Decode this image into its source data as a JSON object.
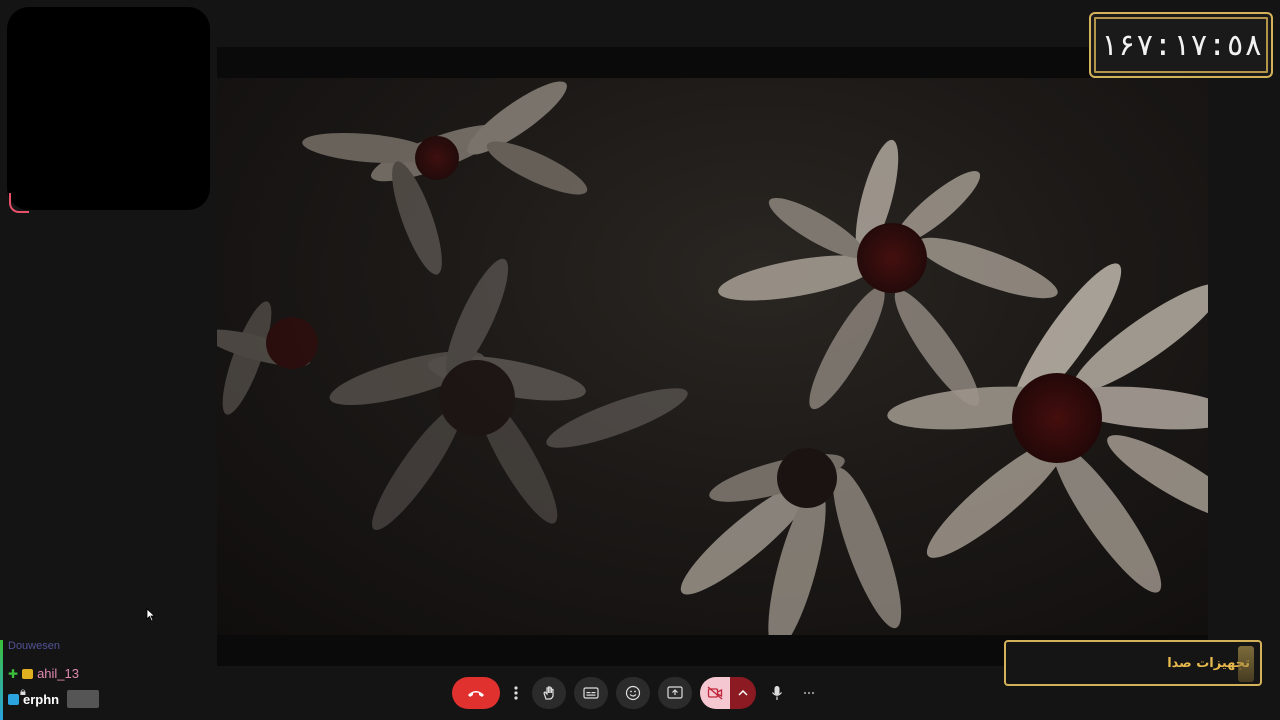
{
  "timer": {
    "text": "١۶٧:١٧:٥٨"
  },
  "stage": {
    "video_label": ""
  },
  "audio_settings": {
    "label": "تجهیزات صدا"
  },
  "controls": {
    "end_call_icon": "phone-hangup",
    "more_icon": "vertical-dots",
    "raise_hand_icon": "hand",
    "captions_icon": "cc",
    "reactions_icon": "smiley",
    "present_icon": "present-screen",
    "camera_icon": "camera-off",
    "camera_options_icon": "chevron-up",
    "mic_icon": "microphone",
    "overflow_icon": "horizontal-dots"
  },
  "chat": {
    "messages": [
      {
        "user": "ahil_13",
        "color": "#e08ab0"
      },
      {
        "user": "erphn",
        "color": "#ffffff"
      }
    ],
    "partial_user": "Douwesen"
  },
  "colors": {
    "accent": "#d4b25a",
    "end_call": "#e0312e",
    "camera_off": "#f4c7d1"
  }
}
